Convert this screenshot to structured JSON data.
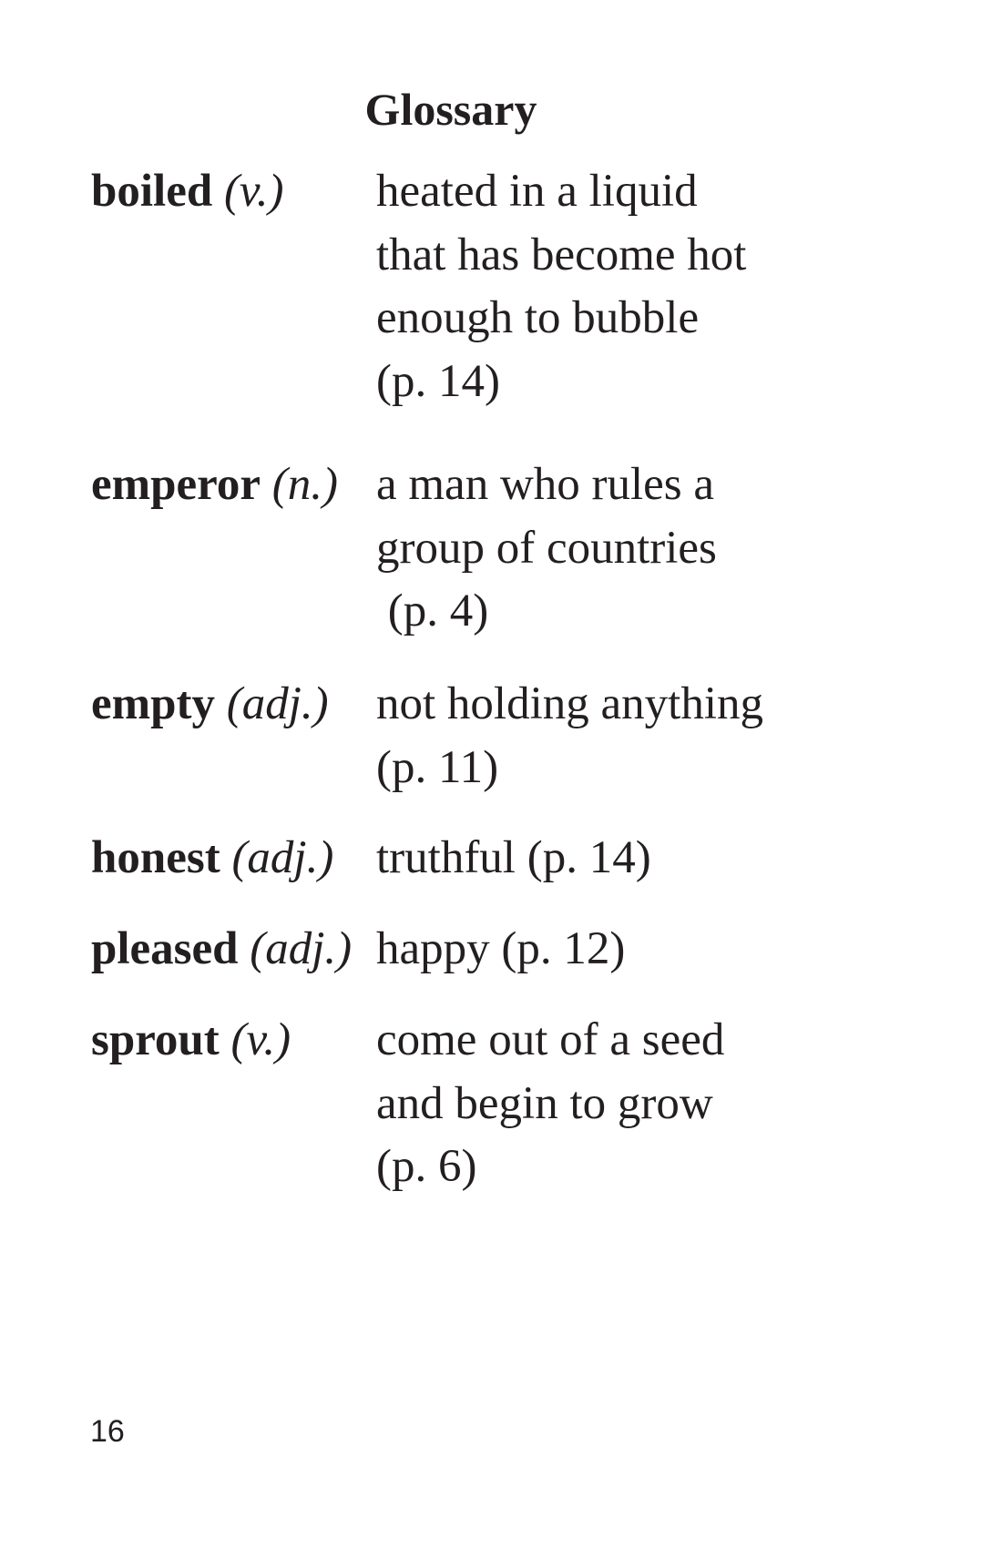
{
  "title": "Glossary",
  "entries": [
    {
      "word": "boiled",
      "pos": "(v.)",
      "definition_lines": [
        "heated in a liquid",
        "that has become hot",
        "enough to bubble",
        "(p. 14)"
      ]
    },
    {
      "word": "emperor",
      "pos": "(n.)",
      "definition_lines": [
        "a man who rules a",
        "group of countries",
        " (p. 4)"
      ]
    },
    {
      "word": "empty",
      "pos": "(adj.)",
      "definition_lines": [
        "not holding anything",
        "(p. 11)"
      ]
    },
    {
      "word": "honest",
      "pos": "(adj.)",
      "definition_lines": [
        "truthful (p. 14)"
      ]
    },
    {
      "word": "pleased",
      "pos": "(adj.)",
      "definition_lines": [
        "happy (p. 12)"
      ]
    },
    {
      "word": "sprout",
      "pos": "(v.)",
      "definition_lines": [
        "come out of a seed",
        "and begin to grow",
        "(p. 6)"
      ]
    }
  ],
  "page_number": "16"
}
